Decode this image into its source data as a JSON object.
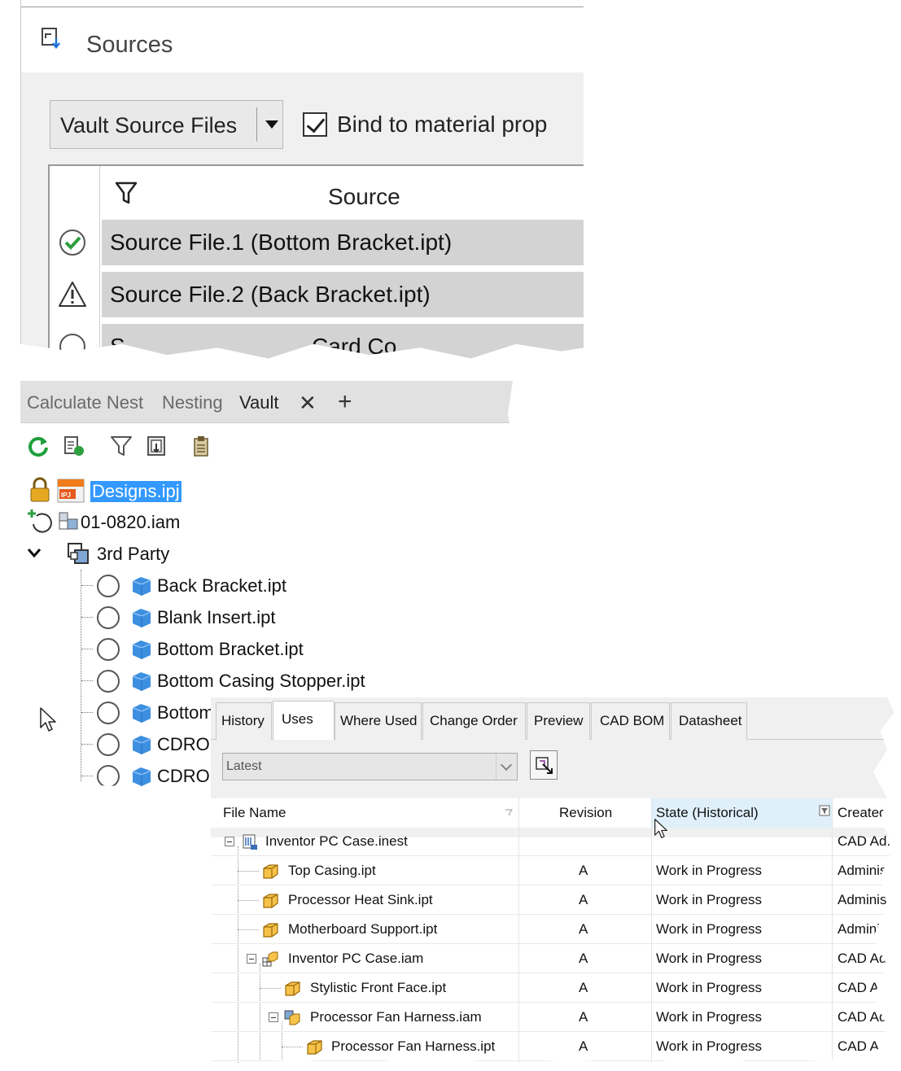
{
  "sources_panel": {
    "title": "Sources",
    "source_type": "Vault Source Files",
    "bind_checkbox_label": "Bind to material prop",
    "bind_checked": true,
    "column_header": "Source",
    "rows": [
      {
        "status": "ok",
        "label": "Source File.1 (Bottom Bracket.ipt)"
      },
      {
        "status": "warning",
        "label": "Source File.2 (Back Bracket.ipt)"
      },
      {
        "status": "none",
        "label_left": "S",
        "label_right": "Card Co"
      }
    ]
  },
  "vault_panel": {
    "tabs": [
      "Calculate Nest",
      "Nesting",
      "Vault"
    ],
    "active_tab": "Vault",
    "toolbar_icons": [
      "refresh-icon",
      "check-in-icon",
      "filter-icon",
      "insert-icon",
      "clipboard-icon"
    ],
    "tree": {
      "project": "Designs.ipj",
      "assembly": "01-0820.iam",
      "folder": "3rd Party",
      "items": [
        "Back Bracket.ipt",
        "Blank Insert.ipt",
        "Bottom Bracket.ipt",
        "Bottom Casing Stopper.ipt",
        "Bottom",
        "CDRO",
        "CDRO"
      ]
    }
  },
  "uses_panel": {
    "tabs": [
      "History",
      "Uses",
      "Where Used",
      "Change Order",
      "Preview",
      "CAD BOM",
      "Datasheet"
    ],
    "active_tab": "Uses",
    "version_dropdown": "Latest",
    "columns": [
      "File Name",
      "Revision",
      "State (Historical)",
      "Created"
    ],
    "rows": [
      {
        "name": "Inventor PC Case.inest",
        "revision": "",
        "state": "",
        "created": "CAD Ad."
      },
      {
        "name": "Top Casing.ipt",
        "revision": "A",
        "state": "Work in Progress",
        "created": "Administr"
      },
      {
        "name": "Processor Heat Sink.ipt",
        "revision": "A",
        "state": "Work in Progress",
        "created": "Administ"
      },
      {
        "name": "Motherboard Support.ipt",
        "revision": "A",
        "state": "Work in Progress",
        "created": "Adminis"
      },
      {
        "name": "Inventor PC Case.iam",
        "revision": "A",
        "state": "Work in Progress",
        "created": "CAD Ad"
      },
      {
        "name": "Stylistic Front Face.ipt",
        "revision": "A",
        "state": "Work in Progress",
        "created": "CAD Adn"
      },
      {
        "name": "Processor Fan Harness.iam",
        "revision": "A",
        "state": "Work in Progress",
        "created": "CAD Ad"
      },
      {
        "name": "Processor Fan Harness.ipt",
        "revision": "A",
        "state": "Work in Progress",
        "created": "CAD A"
      }
    ]
  },
  "colors": {
    "selection": "#3399ff",
    "ok_green": "#2e9e3e",
    "part_orange": "#e8a317",
    "part_blue": "#3d8fe0",
    "header_highlight": "#dff0fb"
  }
}
